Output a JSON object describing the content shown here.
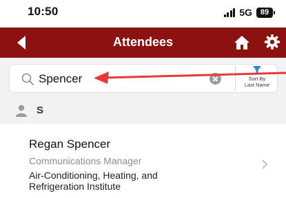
{
  "status_bar": {
    "time": "10:50",
    "network": "5G",
    "battery": "89"
  },
  "nav": {
    "title": "Attendees",
    "back_icon": "back-arrow-icon",
    "home_icon": "home-icon",
    "settings_icon": "gear-icon"
  },
  "search": {
    "value": "Spencer",
    "sort_label_line1": "Sort By",
    "sort_label_line2": "Last Name"
  },
  "section": {
    "letter": "S"
  },
  "attendees": [
    {
      "name": "Regan Spencer",
      "title": "Communications Manager",
      "organization": "Air-Conditioning, Heating, and Refrigeration Institute"
    }
  ],
  "colors": {
    "nav_background": "#8b1211",
    "accent_blue": "#2a86e0",
    "annotation_red": "#e8383b"
  }
}
